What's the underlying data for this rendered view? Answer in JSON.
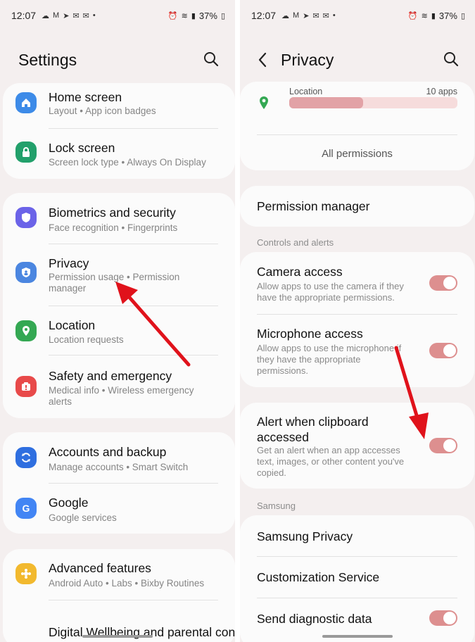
{
  "left": {
    "status": {
      "time": "12:07",
      "battery": "37%"
    },
    "title": "Settings",
    "items": [
      {
        "label": "Home screen",
        "sub": "Layout  •  App icon badges",
        "color": "#3d8be8"
      },
      {
        "label": "Lock screen",
        "sub": "Screen lock type  •  Always On Display",
        "color": "#22a06b"
      },
      {
        "label": "Biometrics and security",
        "sub": "Face recognition  •  Fingerprints",
        "color": "#6b63e8"
      },
      {
        "label": "Privacy",
        "sub": "Permission usage  •  Permission manager",
        "color": "#4b86e0"
      },
      {
        "label": "Location",
        "sub": "Location requests",
        "color": "#34a853"
      },
      {
        "label": "Safety and emergency",
        "sub": "Medical info  •  Wireless emergency alerts",
        "color": "#e84a4a"
      },
      {
        "label": "Accounts and backup",
        "sub": "Manage accounts  •  Smart Switch",
        "color": "#2f6fe0"
      },
      {
        "label": "Google",
        "sub": "Google services",
        "color": "#4285f4"
      },
      {
        "label": "Advanced features",
        "sub": "Android Auto  •  Labs  •  Bixby Routines",
        "color": "#f2b92e"
      },
      {
        "label": "Digital Wellbeing and parental controls",
        "sub": "",
        "color": "#34a853"
      }
    ]
  },
  "right": {
    "status": {
      "time": "12:07",
      "battery": "37%"
    },
    "title": "Privacy",
    "location_label": "Location",
    "location_count": "10 apps",
    "location_usage_fraction": 0.44,
    "all_permissions": "All permissions",
    "permission_manager": "Permission manager",
    "controls_header": "Controls and alerts",
    "camera": {
      "label": "Camera access",
      "sub": "Allow apps to use the camera if they have the appropriate permissions."
    },
    "microphone": {
      "label": "Microphone access",
      "sub": "Allow apps to use the microphone if they have the appropriate permissions."
    },
    "clipboard": {
      "label": "Alert when clipboard accessed",
      "sub": "Get an alert when an app accesses text, images, or other content you've copied."
    },
    "samsung_header": "Samsung",
    "samsung_privacy": "Samsung Privacy",
    "customization": "Customization Service",
    "diagnostic": "Send diagnostic data"
  },
  "colors": {
    "accent": "#dd8f8f",
    "arrow": "#e0121b"
  }
}
